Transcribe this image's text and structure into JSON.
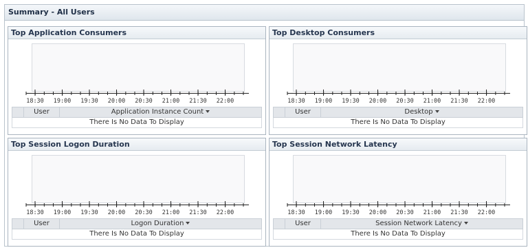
{
  "page": {
    "title": "Summary - All Users"
  },
  "time_ticks": [
    "18:30",
    "19:00",
    "19:30",
    "20:00",
    "20:30",
    "21:00",
    "21:30",
    "22:00"
  ],
  "panels": [
    {
      "title": "Top Application Consumers",
      "col_user": "User",
      "col_metric": "Application Instance Count",
      "no_data": "There Is No Data To Display"
    },
    {
      "title": "Top Desktop Consumers",
      "col_user": "User",
      "col_metric": "Desktop",
      "no_data": "There Is No Data To Display"
    },
    {
      "title": "Top Session Logon Duration",
      "col_user": "User",
      "col_metric": "Logon Duration",
      "no_data": "There Is No Data To Display"
    },
    {
      "title": "Top Session Network Latency",
      "col_user": "User",
      "col_metric": "Session Network Latency",
      "no_data": "There Is No Data To Display"
    }
  ],
  "icons": {
    "sort": "sort-desc-icon"
  }
}
